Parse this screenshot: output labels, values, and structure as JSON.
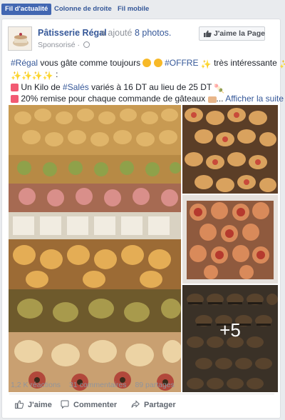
{
  "tabs": [
    {
      "label": "Fil d'actualité",
      "active": true
    },
    {
      "label": "Colonne de droite",
      "active": false
    },
    {
      "label": "Fil mobile",
      "active": false
    }
  ],
  "post": {
    "page_name": "Pâtisserie Régal",
    "added_prefix": " a ajouté ",
    "photos_link": "8 photos.",
    "sponsored": "Sponsorisé · ",
    "like_page_label": "J'aime la Page",
    "lines": {
      "l1_hash1": "#Régal",
      "l1_text1": " vous gâte comme toujours ",
      "l1_hash2": "#OFFRE",
      "l1_text2": " très intéressante ",
      "l3_text1": " Un Kilo de ",
      "l3_hash": "#Salés",
      "l3_text2": " variés à 16 DT au lieu de 25 DT ",
      "l4_text": " 20% remise pour chaque commande de gâteaux ",
      "l4_ellipsis": "... ",
      "more_link": "Afficher la suite"
    },
    "more_photos": "+5",
    "stats": {
      "reactions": "1,2 K réactions",
      "comments": "31 commentaires",
      "shares": "89 partages"
    },
    "actions": {
      "like": "J'aime",
      "comment": "Commenter",
      "share": "Partager"
    }
  },
  "colors": {
    "link": "#365899",
    "active_tab": "#4267b2",
    "secondary_text": "#90949c"
  }
}
